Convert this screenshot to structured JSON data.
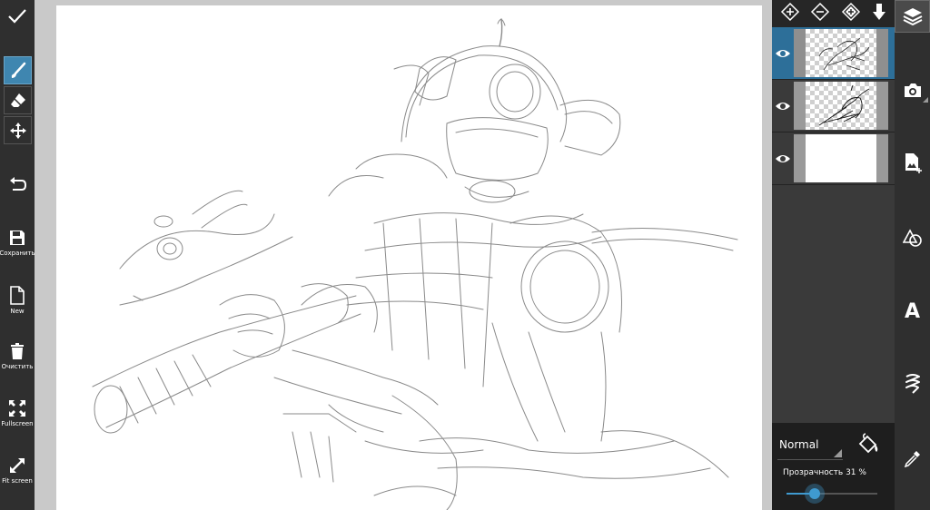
{
  "left_toolbar": {
    "save_label": "Сохранить",
    "new_label": "New",
    "clear_label": "Очистить",
    "fullscreen_label": "Fullscreen",
    "fit_label": "Fit screen"
  },
  "layers": {
    "blend_mode": "Normal",
    "opacity_text": "Прозрачность  31 %",
    "opacity_value": 0.31,
    "items": [
      {
        "type": "sketch",
        "selected": true,
        "visible": true
      },
      {
        "type": "sketch",
        "selected": false,
        "visible": true
      },
      {
        "type": "background",
        "selected": false,
        "visible": true
      }
    ]
  },
  "colors": {
    "accent": "#3f86b0",
    "toolbar_bg": "#2f2f2f",
    "panel_bg": "#3a3a3a"
  },
  "right_toolbar": {
    "text_tool_glyph": "A"
  }
}
